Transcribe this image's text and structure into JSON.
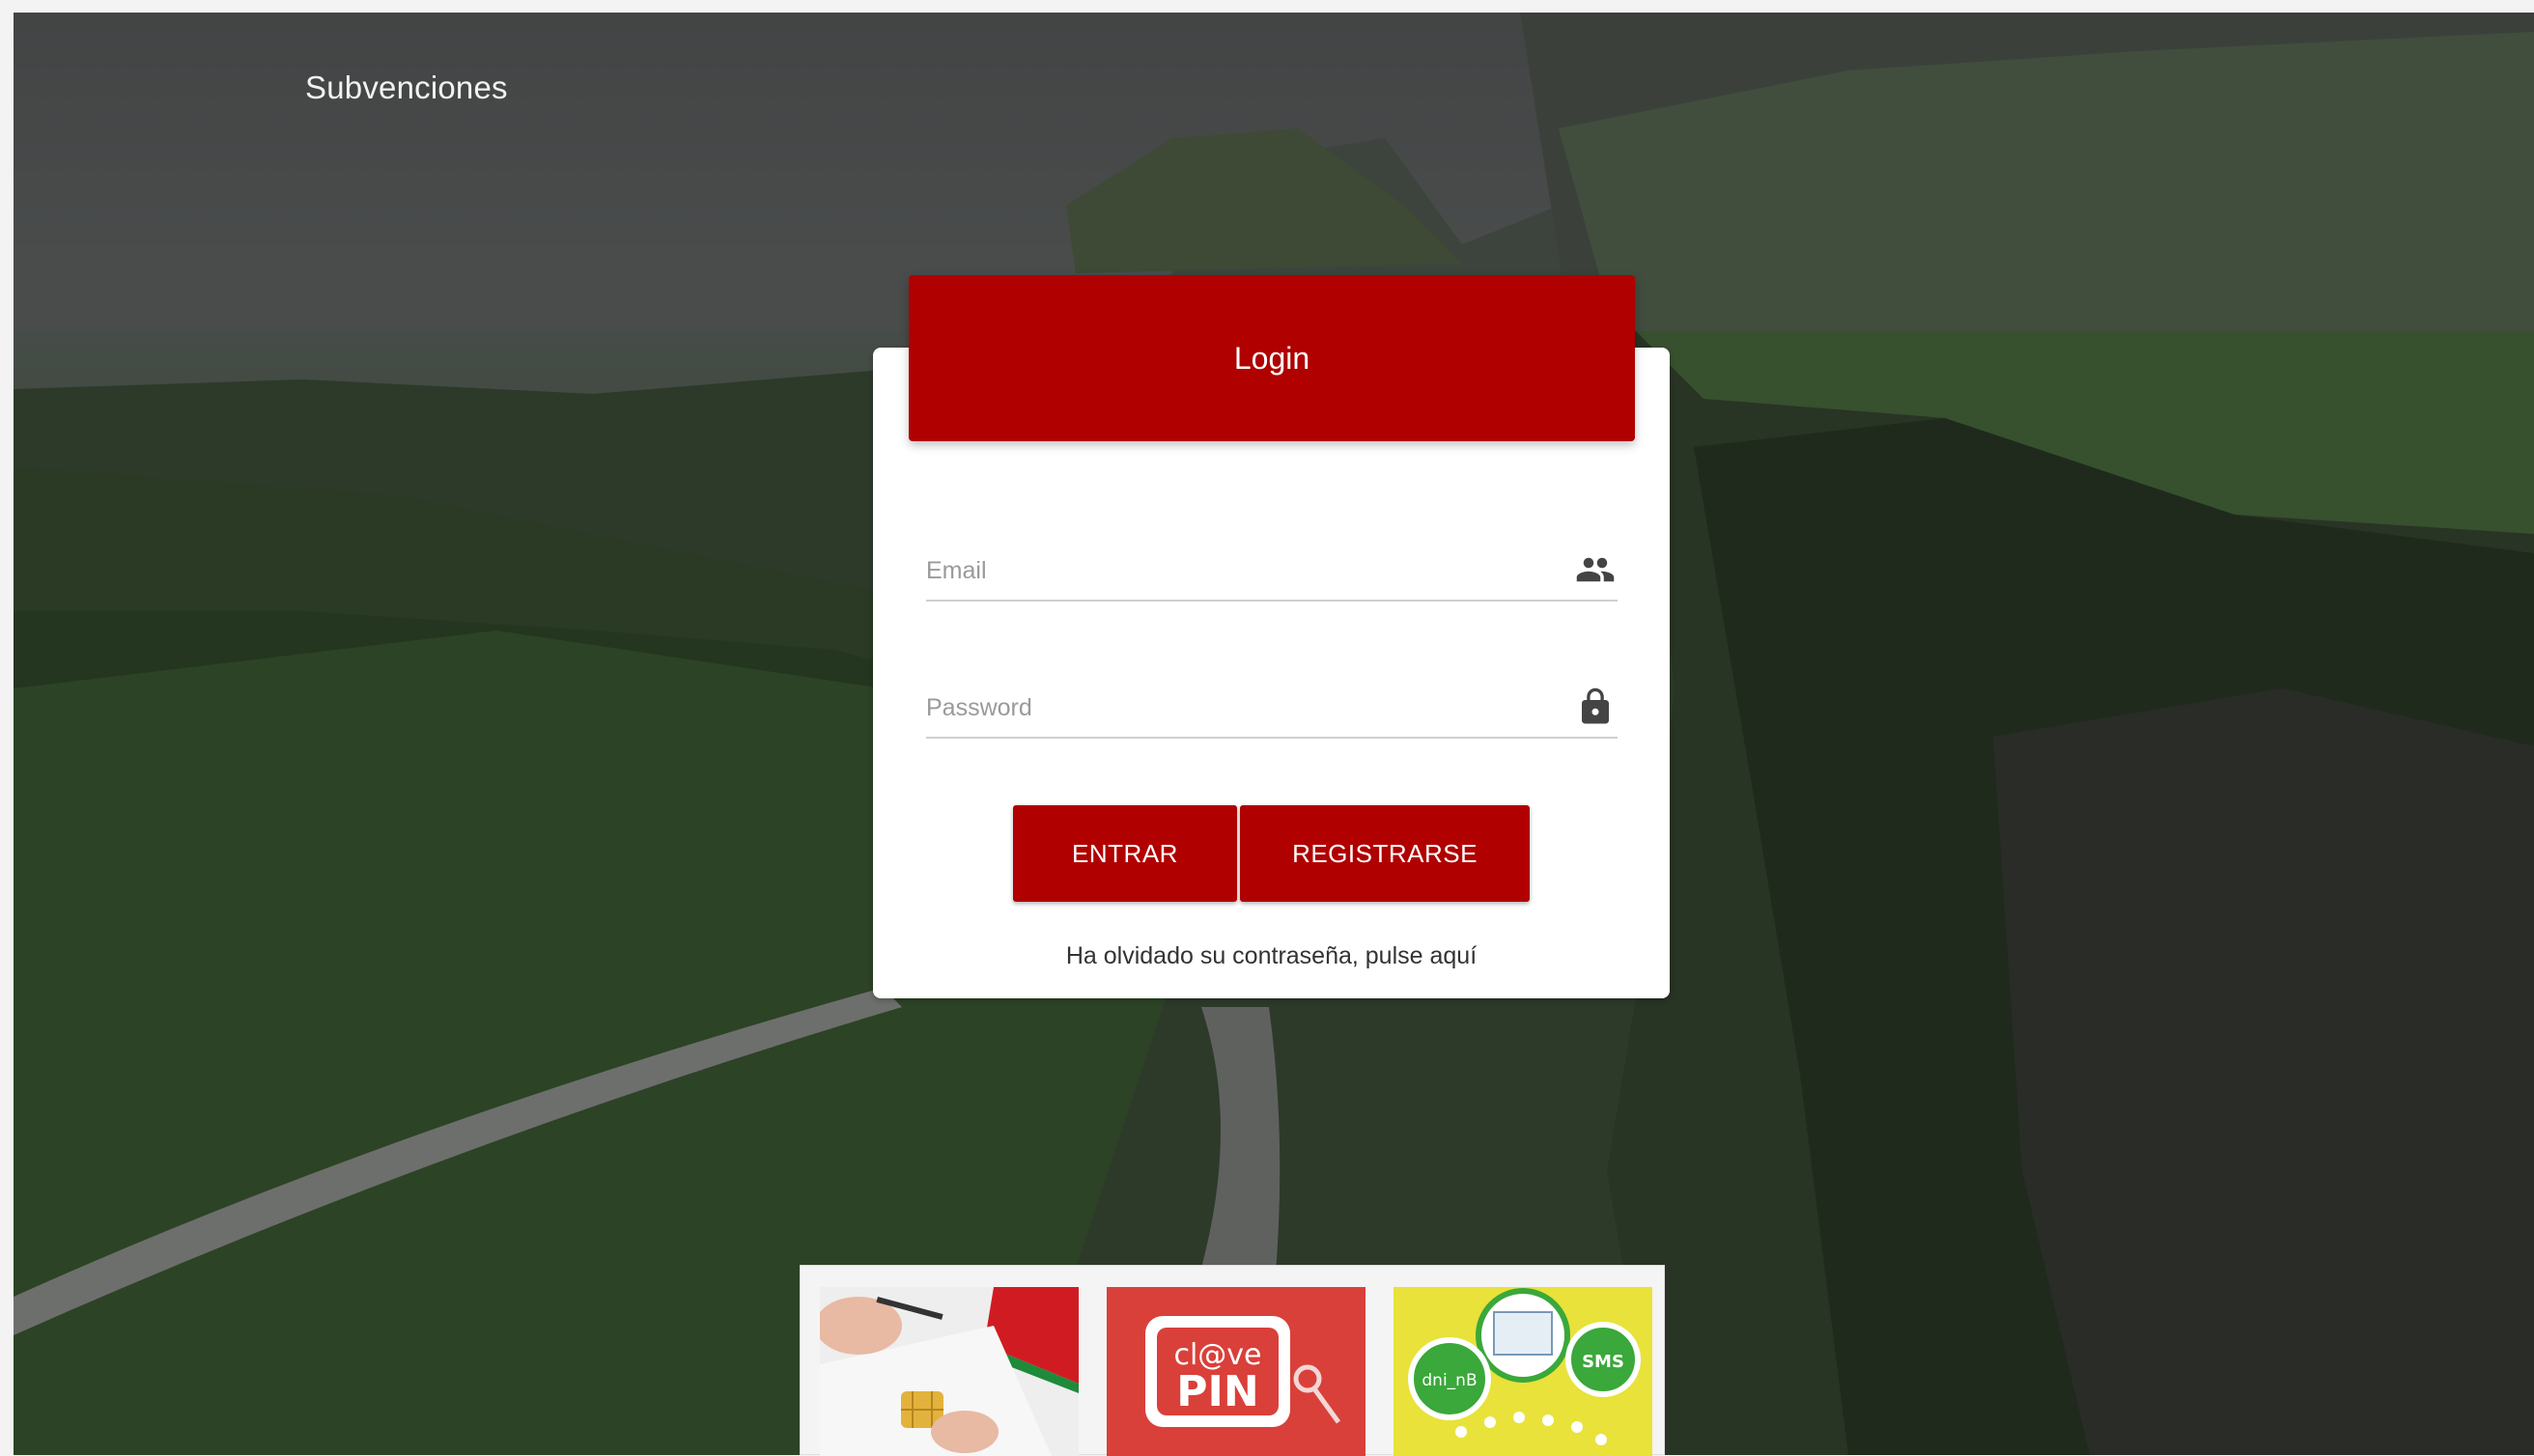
{
  "app": {
    "brand": "Subvenciones"
  },
  "login": {
    "title": "Login",
    "email_placeholder": "Email",
    "password_placeholder": "Password",
    "enter_label": "ENTRAR",
    "register_label": "REGISTRARSE",
    "forgot_label": "Ha olvidado su contraseña, pulse aquí"
  },
  "access_options": {
    "certificate": {
      "icon": "digital-certificate-icon",
      "text": ""
    },
    "clave_pin": {
      "icon": "clave-pin-icon",
      "text": "cl@ve PIN"
    },
    "dni_sms": {
      "icon": "dni-sms-icon",
      "dni_text": "dni_nB",
      "sms_text": "SMS"
    }
  },
  "colors": {
    "primary": "#b00000",
    "card": "#ffffff",
    "brand_text": "#f2f2f2"
  }
}
